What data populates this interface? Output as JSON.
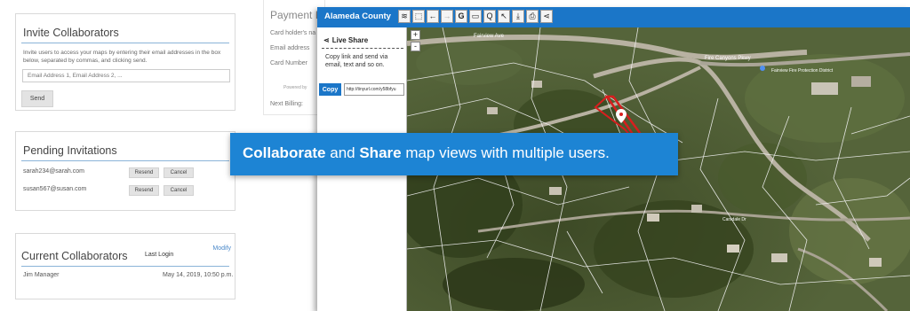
{
  "invite": {
    "title": "Invite Collaborators",
    "description": "Invite users to access your maps by entering their email addresses in the box below, separated by commas, and clicking send.",
    "email_placeholder": "Email Address 1, Email Address 2, ...",
    "send_label": "Send"
  },
  "pending": {
    "title": "Pending Invitations",
    "rows": [
      {
        "email": "sarah234@sarah.com",
        "resend": "Resend",
        "cancel": "Cancel"
      },
      {
        "email": "susan567@susan.com",
        "resend": "Resend",
        "cancel": "Cancel"
      }
    ]
  },
  "current": {
    "title": "Current Collaborators",
    "last_login_header": "Last Login",
    "modify_label": "Modify",
    "rows": [
      {
        "name": "Jim Manager",
        "last_login": "May 14, 2019, 10:50 p.m."
      }
    ]
  },
  "payment": {
    "title": "Payment In",
    "labels": [
      "Card holder's na",
      "Email address",
      "Card Number"
    ],
    "powered_by": "Powered by",
    "next_billing": "Next Billing:"
  },
  "map_window": {
    "title": "Alameda County",
    "toolbar_icons": [
      "layers-icon",
      "select-icon",
      "back-icon",
      "forward-icon",
      "google-icon",
      "measure-icon",
      "search-icon",
      "identify-icon",
      "download-icon",
      "print-icon",
      "share-icon"
    ],
    "zoom_in": "+",
    "zoom_out": "-"
  },
  "share_panel": {
    "title": "Live Share",
    "description": "Copy link and send via email, text and so on.",
    "copy_label": "Copy",
    "link_value": "http://tinyurl.com/y58bfyu"
  },
  "map_labels": {
    "road_1": "Fairview Ave",
    "road_2": "Fire Canyons Pkwy",
    "place_1": "Fairview Fire Protection District",
    "road_3": "Carsdale Dr"
  },
  "banner": {
    "word_1": "Collaborate",
    "text_1": " and ",
    "word_2": "Share",
    "text_2": " map views with multiple users."
  },
  "colors": {
    "accent": "#1b76c8",
    "banner": "#1d84d4",
    "parcel_highlight": "#d81e1e"
  }
}
